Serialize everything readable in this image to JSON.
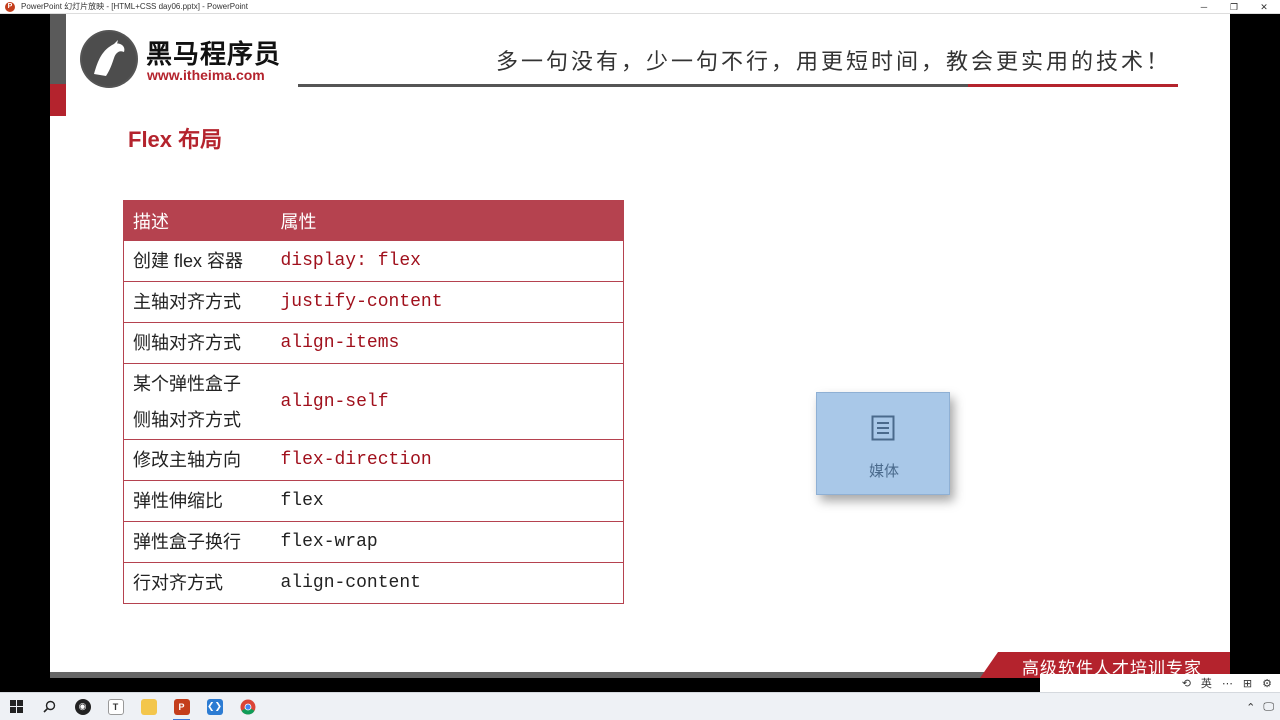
{
  "window": {
    "title": "PowerPoint 幻灯片放映 - [HTML+CSS day06.pptx] - PowerPoint",
    "minimize": "─",
    "restore": "❐",
    "close": "✕"
  },
  "slide": {
    "logo_name": "黑马程序员",
    "logo_url": "www.itheima.com",
    "slogan": "多一句没有，少一句不行，用更短时间，教会更实用的技术！",
    "heading": "Flex 布局",
    "table": {
      "headers": [
        "描述",
        "属性"
      ],
      "rows": [
        {
          "desc": "创建 flex 容器",
          "prop": "display: flex"
        },
        {
          "desc": "主轴对齐方式",
          "prop": "justify-content"
        },
        {
          "desc": "侧轴对齐方式",
          "prop": "align-items"
        },
        {
          "desc_line1": "某个弹性盒子",
          "desc_line2": "侧轴对齐方式",
          "prop": "align-self"
        },
        {
          "desc": "修改主轴方向",
          "prop": "flex-direction"
        },
        {
          "desc": "弹性伸缩比",
          "prop": "flex"
        },
        {
          "desc": "弹性盒子换行",
          "prop": "flex-wrap"
        },
        {
          "desc": "行对齐方式",
          "prop": "align-content"
        }
      ]
    },
    "media_placeholder": {
      "label": "媒体",
      "icon": "document-icon"
    },
    "corner_banner": "高级软件人才培训专家"
  },
  "slideshow_controls": {
    "lang": "英"
  },
  "taskbar": {
    "items": [
      {
        "name": "start",
        "icon": "windows-icon"
      },
      {
        "name": "search",
        "icon": "search-icon"
      },
      {
        "name": "app-dark",
        "icon": "circle-app-icon"
      },
      {
        "name": "typora",
        "icon": "T"
      },
      {
        "name": "explorer",
        "icon": "folder-icon"
      },
      {
        "name": "powerpoint",
        "icon": "P"
      },
      {
        "name": "vscode",
        "icon": "vscode-icon"
      },
      {
        "name": "chrome",
        "icon": "chrome-icon"
      }
    ]
  },
  "colors": {
    "brand_red": "#b4232d",
    "table_header": "#b5424f",
    "code_red": "#a0101c",
    "media_blue": "#a9c8e8"
  }
}
